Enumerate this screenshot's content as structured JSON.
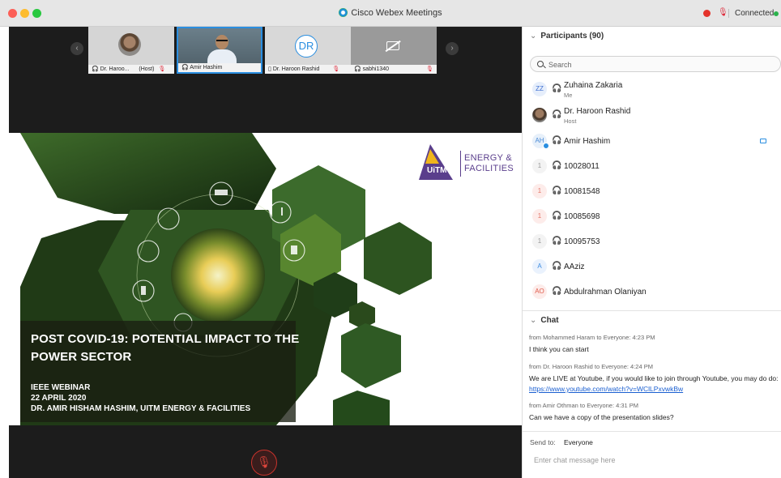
{
  "window": {
    "title": "Cisco Webex Meetings",
    "connection_status": "Connected",
    "colors": {
      "accent": "#2a8ee0",
      "connected": "#2bb24c",
      "record": "#e4332b"
    }
  },
  "video_strip": {
    "tiles": [
      {
        "name": "Dr. Haroo...",
        "role": "(Host)",
        "muted": true
      },
      {
        "name": "Amir Hashim",
        "muted": false,
        "active_speaker": true
      },
      {
        "name": "Dr. Haroon Rashid",
        "initials": "DR",
        "muted": true
      },
      {
        "name": "sabhi1340",
        "video_off": true,
        "muted": true
      }
    ]
  },
  "slide": {
    "title": "POST COVID-19: POTENTIAL IMPACT TO THE POWER SECTOR",
    "event": "IEEE WEBINAR",
    "date": "22 APRIL 2020",
    "speaker": "DR. AMIR HISHAM HASHIM, UITM ENERGY & FACILITIES",
    "logo": {
      "mark": "UiTM",
      "line1": "ENERGY &",
      "line2": "FACILITIES"
    }
  },
  "participants": {
    "header": "Participants (90)",
    "search_placeholder": "Search",
    "list": [
      {
        "initials": "ZZ",
        "name": "Zuhaina Zakaria",
        "role": "Me"
      },
      {
        "initials": "",
        "name": "Dr. Haroon Rashid",
        "role": "Host"
      },
      {
        "initials": "AH",
        "name": "Amir Hashim",
        "role": "",
        "video": true
      },
      {
        "initials": "1",
        "name": "10028011"
      },
      {
        "initials": "1",
        "name": "10081548"
      },
      {
        "initials": "1",
        "name": "10085698"
      },
      {
        "initials": "1",
        "name": "10095753"
      },
      {
        "initials": "A",
        "name": "AAziz"
      },
      {
        "initials": "AO",
        "name": "Abdulrahman Olaniyan"
      }
    ]
  },
  "chat": {
    "header": "Chat",
    "messages": [
      {
        "meta": "from Mohammed Haram to Everyone:   4:23  PM",
        "text": "I think you can start"
      },
      {
        "meta": "from Dr. Haroon Rashid to Everyone:   4:24  PM",
        "text": "We are LIVE at Youtube, if you would like to join through Youtube, you may do do:",
        "link": "https://www.youtube.com/watch?v=WClLPxvwkBw"
      },
      {
        "meta": "from Amir Othman to Everyone:   4:31  PM",
        "text": "Can we have a copy of the presentation slides?"
      }
    ],
    "send_to_label": "Send to:",
    "send_to_value": "Everyone",
    "input_placeholder": "Enter chat message here"
  }
}
